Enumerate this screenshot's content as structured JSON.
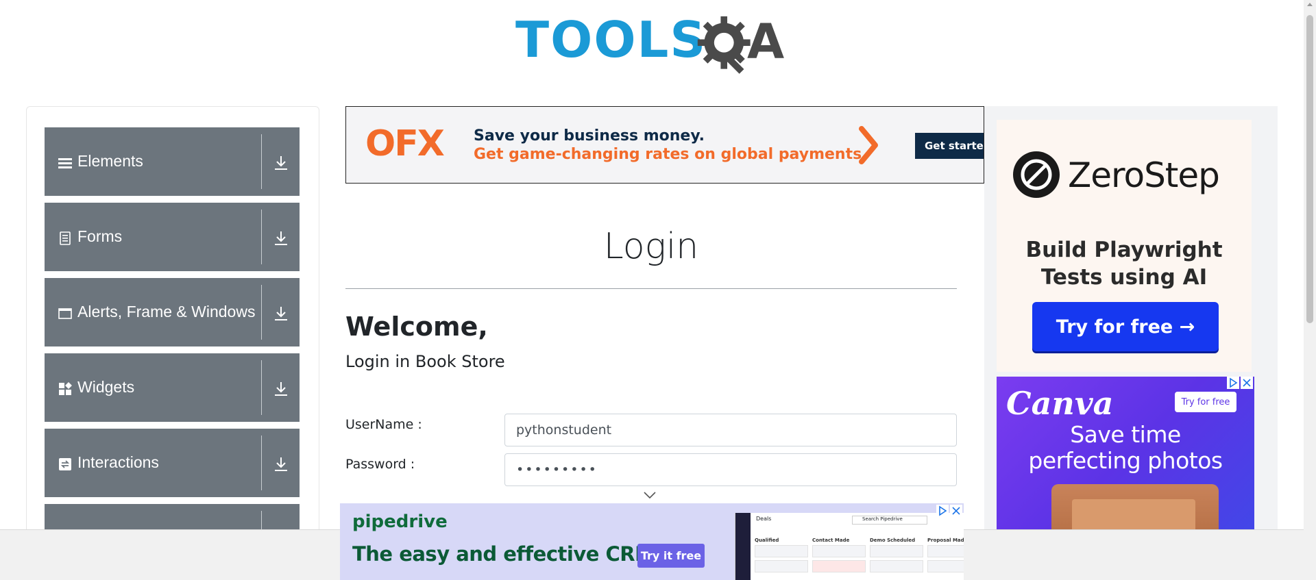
{
  "header": {
    "logo_text": "TOOLS",
    "logo_a": "A"
  },
  "sidebar": {
    "groups": [
      {
        "label": "Elements",
        "icon": "hamburger-icon"
      },
      {
        "label": "Forms",
        "icon": "document-icon"
      },
      {
        "label": "Alerts, Frame & Windows",
        "icon": "window-icon"
      },
      {
        "label": "Widgets",
        "icon": "widgets-icon"
      },
      {
        "label": "Interactions",
        "icon": "interactions-icon"
      }
    ]
  },
  "ads": {
    "top": {
      "brand": "OFX",
      "line1": "Save your business money.",
      "line2": "Get game-changing rates on global payments.",
      "cta": "Get started"
    },
    "zerostep": {
      "brand": "ZeroStep",
      "tag_line1": "Build Playwright",
      "tag_line2": "Tests using AI",
      "cta": "Try for free →"
    },
    "canva": {
      "brand": "Canva",
      "cta": "Try for free",
      "head_line1": "Save time",
      "head_line2": "perfecting photos"
    },
    "bottom": {
      "brand": "pipedrive",
      "slogan": "The easy and effective CRM",
      "cta": "Try it free",
      "mock_title": "Deals",
      "mock_search": "Search Pipedrive",
      "mock_columns": [
        "Qualified",
        "Contact Made",
        "Demo Scheduled",
        "Proposal Made"
      ]
    }
  },
  "main": {
    "page_title": "Login",
    "welcome": "Welcome,",
    "subtitle": "Login in Book Store",
    "username_label": "UserName :",
    "username_value": "pythonstudent",
    "password_label": "Password :",
    "password_value": "•••••••••"
  },
  "colors": {
    "sidebar_group": "#6c757d",
    "logo_blue": "#1b9ad6",
    "ofx_orange": "#f26b2a",
    "zerostep_button": "#1638f0"
  }
}
